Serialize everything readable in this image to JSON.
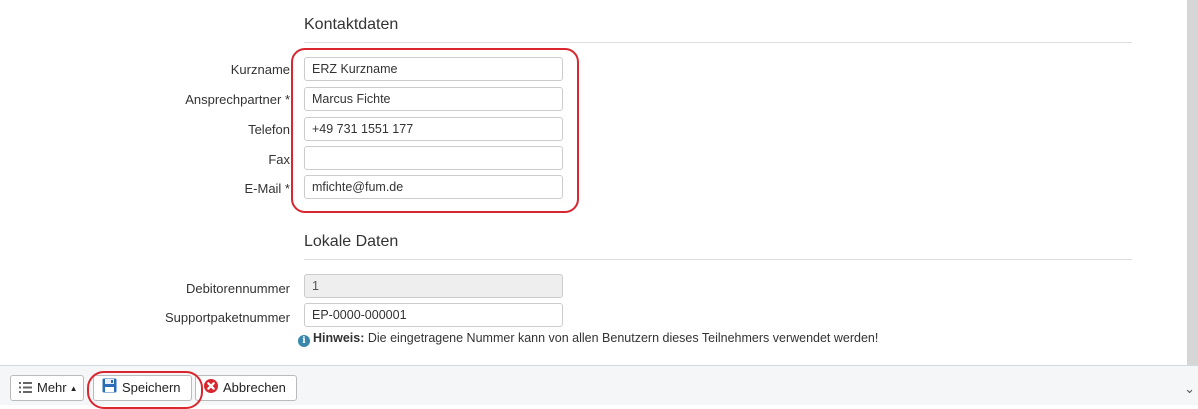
{
  "contact_section": {
    "title": "Kontaktdaten",
    "fields": [
      {
        "label": "Kurzname",
        "value": "ERZ Kurzname"
      },
      {
        "label": "Ansprechpartner *",
        "value": "Marcus Fichte"
      },
      {
        "label": "Telefon",
        "value": "+49 731 1551 177"
      },
      {
        "label": "Fax",
        "value": ""
      },
      {
        "label": "E-Mail *",
        "value": "mfichte@fum.de"
      }
    ]
  },
  "local_section": {
    "title": "Lokale Daten",
    "fields": [
      {
        "label": "Debitorennummer",
        "value": "1",
        "readonly": true
      },
      {
        "label": "Supportpaketnummer",
        "value": "EP-0000-000001",
        "readonly": false
      }
    ],
    "hint_bold": "Hinweis:",
    "hint_text": " Die eingetragene Nummer kann von allen Benutzern dieses Teilnehmers verwendet werden!"
  },
  "footer": {
    "more_label": "Mehr",
    "save_label": "Speichern",
    "cancel_label": "Abbrechen"
  },
  "colors": {
    "annotation": "#d9262f",
    "info": "#3a87ad",
    "cancel": "#d9262f",
    "save": "#2a6cb8"
  }
}
